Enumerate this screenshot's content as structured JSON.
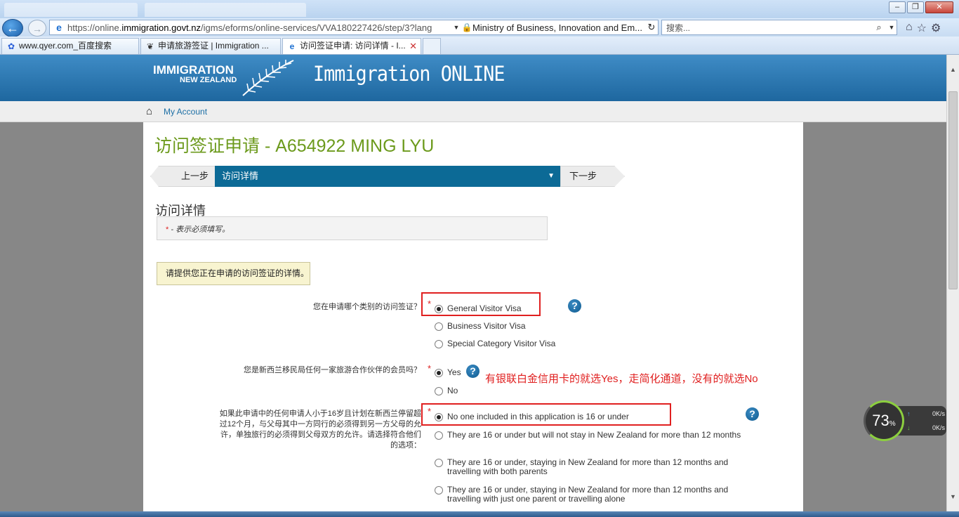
{
  "browser": {
    "address_url_prefix": "https://online.",
    "address_url_domain": "immigration.govt.nz",
    "address_url_rest": "/igms/eforms/online-services/VVA180227426/step/3?lang",
    "site_identity": "Ministry of Business, Innovation and Em...",
    "search_placeholder": "搜索...",
    "tabs": [
      {
        "label": "www.qyer.com_百度搜索"
      },
      {
        "label": "申请旅游签证 | Immigration ..."
      },
      {
        "label": "访问签证申请: 访问详情 - I..."
      }
    ]
  },
  "site": {
    "logo_line1": "IMMIGRATION",
    "logo_line2": "NEW ZEALAND",
    "name": "Immigration ONLINE",
    "account_link": "My Account"
  },
  "form": {
    "app_title": "访问签证申请 - A654922 MING LYU",
    "stepper": {
      "prev": "上一步",
      "current": "访问详情",
      "next": "下一步"
    },
    "section_title": "访问详情",
    "required_star": "*",
    "required_note": "- 表示必须填写。",
    "instruction": "请提供您正在申请的访问签证的详情。",
    "questions": [
      {
        "label": "您在申请哪个类别的访问签证？",
        "options": [
          "General Visitor Visa",
          "Business Visitor Visa",
          "Special Category Visitor Visa"
        ],
        "selected": 0
      },
      {
        "label": "您是新西兰移民局任何一家旅游合作伙伴的会员吗？",
        "options": [
          "Yes",
          "No"
        ],
        "selected": 0
      },
      {
        "label_lines": [
          "如果此申请中的任何申请人小于16岁且计划在新西兰停留超",
          "过12个月，与父母其中一方同行的必须得到另一方父母的允",
          "许，单独旅行的必须得到父母双方的允许。请选择符合他们",
          "的选项："
        ],
        "options": [
          "No one included in this application is 16 or under",
          "They are 16 or under but will not stay in New Zealand for more than 12 months",
          "They are 16 or under, staying in New Zealand for more than 12 months and travelling with both parents",
          "They are 16 or under, staying in New Zealand for more than 12 months and travelling with just one parent or travelling alone"
        ],
        "selected": 0
      }
    ],
    "annotation": "有银联白金信用卡的就选Yes，走简化通道，没有的就选No"
  },
  "net_widget": {
    "percent": "73",
    "percent_unit": "%",
    "up_speed": "0K/s",
    "down_speed": "0K/s"
  },
  "colors": {
    "header_blue": "#2a79b4",
    "title_green": "#6c9a1c",
    "stepper_active": "#0c6a96",
    "annotation_red": "#e02020"
  }
}
